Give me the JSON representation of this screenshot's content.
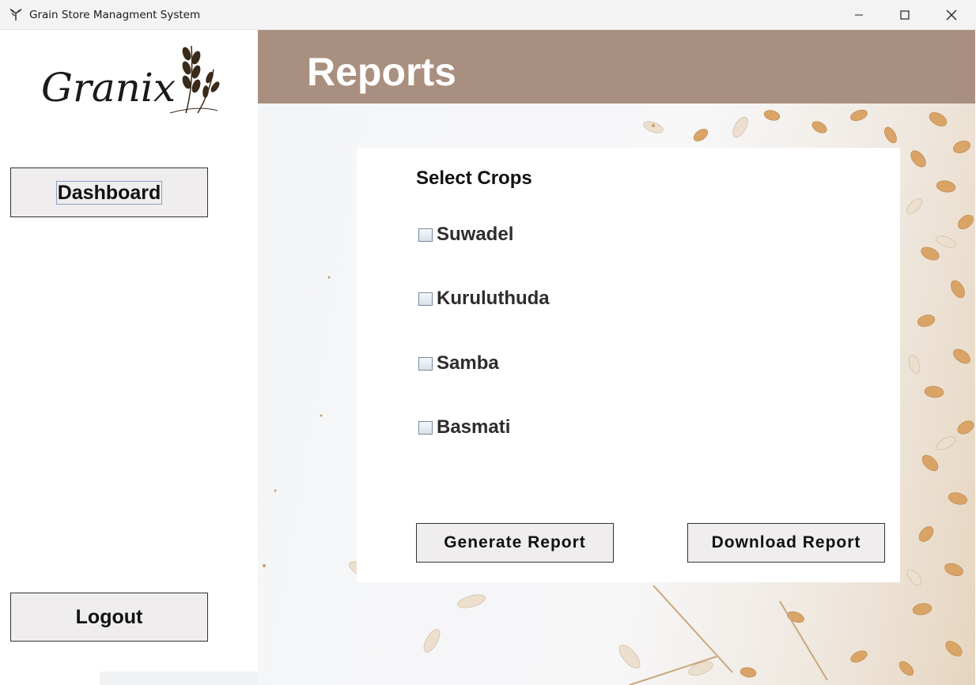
{
  "window": {
    "title": "Grain Store Managment System",
    "icon": "wheat-icon"
  },
  "sidebar": {
    "logo_text": "Granix",
    "dashboard_label": "Dashboard",
    "logout_label": "Logout"
  },
  "header": {
    "title": "Reports",
    "color": "#a98f7f"
  },
  "panel": {
    "heading": "Select Crops",
    "crops": [
      {
        "label": "Suwadel",
        "checked": false
      },
      {
        "label": "Kuruluthuda",
        "checked": false
      },
      {
        "label": "Samba",
        "checked": false
      },
      {
        "label": "Basmati",
        "checked": false
      }
    ],
    "generate_label": "Generate Report",
    "download_label": "Download Report"
  }
}
